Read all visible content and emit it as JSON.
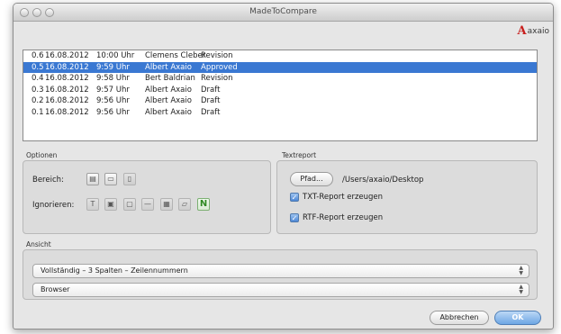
{
  "window": {
    "title": "MadeToCompare"
  },
  "logo": {
    "mark": "A",
    "text": "axaio"
  },
  "versions": [
    {
      "version": "0.6",
      "date": "16.08.2012",
      "time": "10:00 Uhr",
      "author": "Clemens Cleber",
      "status": "Revision",
      "selected": false
    },
    {
      "version": "0.5",
      "date": "16.08.2012",
      "time": "9:59 Uhr",
      "author": "Albert Axaio",
      "status": "Approved",
      "selected": true
    },
    {
      "version": "0.4",
      "date": "16.08.2012",
      "time": "9:58 Uhr",
      "author": "Bert Baldrian",
      "status": "Revision",
      "selected": false
    },
    {
      "version": "0.3",
      "date": "16.08.2012",
      "time": "9:57 Uhr",
      "author": "Albert Axaio",
      "status": "Draft",
      "selected": false
    },
    {
      "version": "0.2",
      "date": "16.08.2012",
      "time": "9:56 Uhr",
      "author": "Albert Axaio",
      "status": "Draft",
      "selected": false
    },
    {
      "version": "0.1",
      "date": "16.08.2012",
      "time": "9:56 Uhr",
      "author": "Albert Axaio",
      "status": "Draft",
      "selected": false
    }
  ],
  "options": {
    "title": "Optionen",
    "bereich_label": "Bereich:",
    "ignorieren_label": "Ignorieren:"
  },
  "textreport": {
    "title": "Textreport",
    "pfad_button": "Pfad...",
    "path": "/Users/axaio/Desktop",
    "txt_label": "TXT-Report erzeugen",
    "txt_checked": true,
    "rtf_label": "RTF-Report erzeugen",
    "rtf_checked": true
  },
  "ansicht": {
    "title": "Ansicht",
    "view_select": "Vollständig – 3 Spalten – Zeilennummern",
    "output_select": "Browser"
  },
  "buttons": {
    "cancel": "Abbrechen",
    "ok": "OK"
  },
  "colors": {
    "selection": "#3a78d2",
    "brand_red": "#c8201e"
  }
}
